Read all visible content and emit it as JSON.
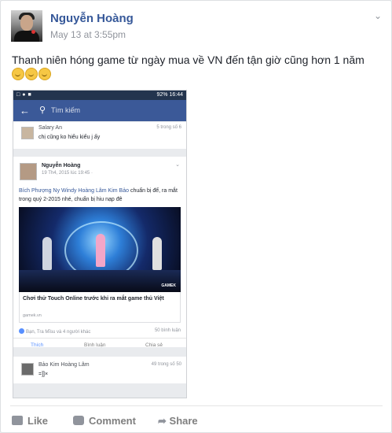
{
  "post": {
    "author": "Nguyễn Hoàng",
    "time": "May 13 at 3:55pm",
    "text": "Thanh niên hóng game từ ngày mua về VN đến tận giờ cũng hơn 1 năm"
  },
  "phone": {
    "status_right": "92% 16:44",
    "search_placeholder": "Tìm kiếm",
    "comment1": {
      "name": "Salary An",
      "text": "chị cũng ko hiểu kiểu j ấy",
      "meta": "5 trong số 6"
    },
    "inner_post": {
      "name": "Nguyễn Hoàng",
      "date": "19 Th4, 2015 lúc 19:45 ·",
      "text_names": "Bích Phượng Ny Windy Hoàng Lâm Kim Bảo",
      "text_rest": " chuẩn bị để, ra mắt trong quý 2-2015 nhé, chuẩn bị hiu nạp đê",
      "image_badge": "GAMEK",
      "link_title": "Chơi thử Touch Online trước khi ra mắt game thủ Việt",
      "link_domain": "gamek.vn",
      "reactions": "Bạn, Tra Mĩsu và 4 người khác",
      "comments_count": "50 bình luận",
      "like": "Thích",
      "comment": "Bình luận",
      "share": "Chia sẻ"
    },
    "comment2": {
      "name": "Bảo Kim Hoàng Lâm",
      "text": "=]]×",
      "meta": "49 trong số 50"
    }
  },
  "footer": {
    "like": "Like",
    "comment": "Comment",
    "share": "Share"
  }
}
